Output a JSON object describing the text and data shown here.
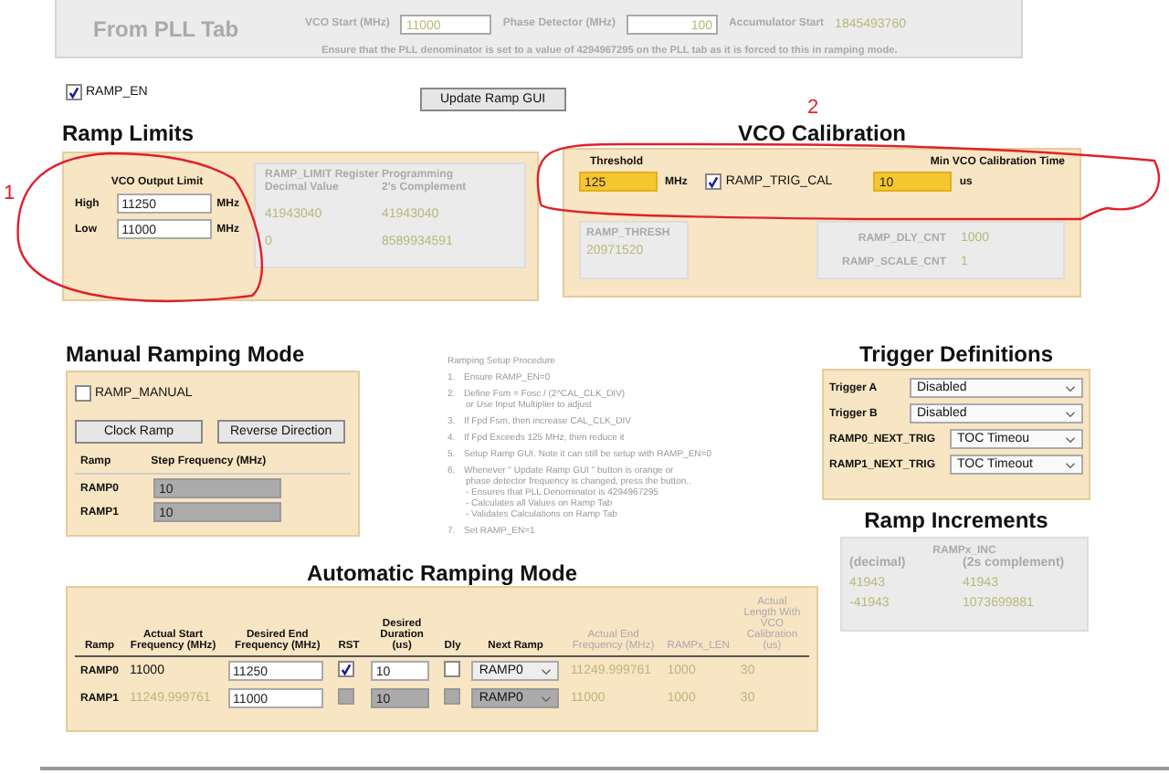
{
  "pll_panel": {
    "title": "From PLL Tab",
    "fields": [
      {
        "label": "VCO Start (MHz)",
        "value": "11000"
      },
      {
        "label": "Phase Detector (MHz)",
        "value": "100"
      }
    ],
    "accumulator": {
      "label": "Accumulator Start",
      "value": "1845493760"
    },
    "notice": "Ensure that the PLL denominator is set to a value of 4294967295 on the PLL tab as it is forced to this in ramping mode."
  },
  "ramp_en": {
    "label": "RAMP_EN",
    "checked": true
  },
  "update_button": "Update Ramp GUI",
  "ramp_limits": {
    "title": "Ramp Limits",
    "output_limit": {
      "title": "VCO Output Limit",
      "rows": [
        {
          "label": "High",
          "value": "11250",
          "unit": "MHz"
        },
        {
          "label": "Low",
          "value": "11000",
          "unit": "MHz"
        }
      ]
    },
    "register": {
      "title": "RAMP_LIMIT Register Programming",
      "columns": [
        "Decimal Value",
        "2's Complement"
      ],
      "rows": [
        [
          "41943040",
          "41943040"
        ],
        [
          "0",
          "8589934591"
        ]
      ]
    }
  },
  "vco_calibration": {
    "title": "VCO Calibration",
    "threshold": {
      "label": "Threshold",
      "value": "125",
      "unit": "MHz"
    },
    "trig_cal": {
      "label": "RAMP_TRIG_CAL",
      "checked": true
    },
    "min_time": {
      "label": "Min VCO Calibration Time",
      "value": "10",
      "unit": "us"
    },
    "thresh_reg": {
      "label": "RAMP_THRESH",
      "value": "20971520"
    },
    "counts": [
      {
        "label": "RAMP_DLY_CNT",
        "value": "1000"
      },
      {
        "label": "RAMP_SCALE_CNT",
        "value": "1"
      }
    ]
  },
  "manual": {
    "title": "Manual Ramping Mode",
    "ramp_manual": {
      "label": "RAMP_MANUAL",
      "checked": false
    },
    "buttons": [
      "Clock Ramp",
      "Reverse Direction"
    ],
    "columns": [
      "Ramp",
      "Step Frequency (MHz)"
    ],
    "rows": [
      {
        "ramp": "RAMP0",
        "step": "10"
      },
      {
        "ramp": "RAMP1",
        "step": "10"
      }
    ]
  },
  "procedure": {
    "title": "Ramping Setup Procedure",
    "steps": [
      {
        "number": "1.",
        "lines": [
          "Ensure RAMP_EN=0"
        ]
      },
      {
        "number": "2.",
        "lines": [
          "Define  Fsm = Fosc / (2^CAL_CLK_DIV)",
          "or Use Input Multiplier to adjust"
        ]
      },
      {
        "number": "3.",
        "lines": [
          "If Fpd   Fsm, then increase CAL_CLK_DIV"
        ]
      },
      {
        "number": "4.",
        "lines": [
          "If Fpd Exceeds 125 MHz, then reduce it"
        ]
      },
      {
        "number": "5.",
        "lines": [
          "Setup Ramp GUI.  Note it can still be setup with RAMP_EN=0"
        ]
      },
      {
        "number": "6.",
        "lines": [
          "Whenever  \" Update Ramp GUI \"  button is orange or",
          "phase detector frequency is changed, press the button..",
          "- Ensures that PLL Denominator is 4294967295",
          "- Calculates all Values on Ramp Tab",
          "- Validates Calculations on Ramp Tab"
        ]
      },
      {
        "number": "7.",
        "lines": [
          "Set RAMP_EN=1"
        ]
      }
    ]
  },
  "trigger": {
    "title": "Trigger Definitions",
    "rows": [
      {
        "label": "Trigger A",
        "value": "Disabled"
      },
      {
        "label": "Trigger  B",
        "value": "Disabled"
      },
      {
        "label": "RAMP0_NEXT_TRIG",
        "value": "TOC Timeou"
      },
      {
        "label": "RAMP1_NEXT_TRIG",
        "value": "TOC Timeout"
      }
    ]
  },
  "increments": {
    "title": "Ramp Increments",
    "header": "RAMPx_INC",
    "columns": [
      "(decimal)",
      "(2s complement)"
    ],
    "rows": [
      [
        "41943",
        "41943"
      ],
      [
        "-41943",
        "1073699881"
      ]
    ]
  },
  "automatic": {
    "title": "Automatic Ramping Mode",
    "columns": [
      {
        "label": "Ramp",
        "kind": "input"
      },
      {
        "label": "Actual Start Frequency (MHz)",
        "kind": "input"
      },
      {
        "label": "Desired End Frequency (MHz)",
        "kind": "input"
      },
      {
        "label": "RST",
        "kind": "input"
      },
      {
        "label": "Desired Duration (us)",
        "kind": "input"
      },
      {
        "label": "Dly",
        "kind": "input"
      },
      {
        "label": "Next Ramp",
        "kind": "input"
      },
      {
        "label": "Actual End Frequency (MHz)",
        "kind": "output"
      },
      {
        "label": "RAMPx_LEN",
        "kind": "output"
      },
      {
        "label": "Actual Length With VCO Calibration (us)",
        "kind": "output"
      }
    ],
    "rows": [
      {
        "ramp": "RAMP0",
        "start": "11000",
        "end": "11250",
        "rst": true,
        "duration": "10",
        "dly": false,
        "next": "RAMP0",
        "actual_end": "11249.999761",
        "len": "1000",
        "actual_length": "30",
        "disabled": false
      },
      {
        "ramp": "RAMP1",
        "start": "11249.999761",
        "end": "11000",
        "rst": false,
        "duration": "10",
        "dly": false,
        "next": "RAMP0",
        "actual_end": "11000",
        "len": "1000",
        "actual_length": "30",
        "disabled": true
      }
    ]
  },
  "annotations": [
    {
      "number": "1"
    },
    {
      "number": "2"
    }
  ]
}
